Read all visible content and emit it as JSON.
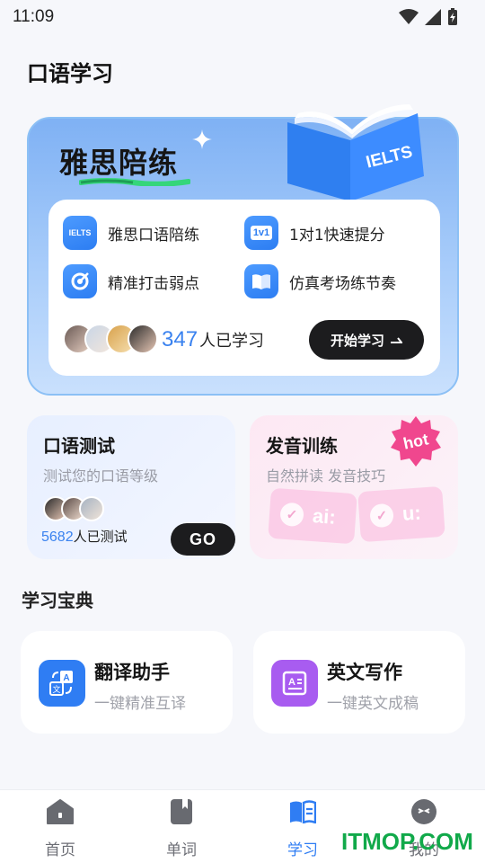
{
  "status_bar": {
    "time": "11:09"
  },
  "page": {
    "title": "口语学习"
  },
  "hero": {
    "title": "雅思陪练",
    "book_label": "IELTS",
    "features": [
      {
        "label": "雅思口语陪练",
        "icon": "ielts-icon",
        "icon_text": "IELTS"
      },
      {
        "label": "1对1快速提分",
        "icon": "one-on-one-icon",
        "icon_text": "1v1"
      },
      {
        "label": "精准打击弱点",
        "icon": "target-icon"
      },
      {
        "label": "仿真考场练节奏",
        "icon": "book-icon"
      }
    ],
    "learned_count": "347",
    "learned_text": "人已学习",
    "start_button": "开始学习"
  },
  "oral_test": {
    "title": "口语测试",
    "subtitle": "测试您的口语等级",
    "tested_count": "5682",
    "tested_text": "人已测试",
    "go_button": "GO"
  },
  "pronunciation": {
    "title": "发音训练",
    "subtitle": "自然拼读 发音技巧",
    "badge": "hot",
    "phonemes": [
      "ai:",
      "u:"
    ]
  },
  "treasury": {
    "title": "学习宝典",
    "tools": [
      {
        "title": "翻译助手",
        "subtitle": "一键精准互译",
        "icon": "translate-icon",
        "color": "#2f7df3"
      },
      {
        "title": "英文写作",
        "subtitle": "一键英文成稿",
        "icon": "writing-icon",
        "color": "#a85cf0"
      }
    ]
  },
  "nav": {
    "items": [
      {
        "label": "首页",
        "icon": "home-icon"
      },
      {
        "label": "单词",
        "icon": "notebook-icon"
      },
      {
        "label": "学习",
        "icon": "study-book-icon",
        "active": true
      },
      {
        "label": "我的",
        "icon": "profile-icon"
      }
    ]
  },
  "watermark": "ITMOP.COM",
  "colors": {
    "accent": "#2f7df3",
    "hero_bg": "#a9cdfa",
    "dark_button": "#1c1c1e",
    "watermark": "#11a94a"
  }
}
